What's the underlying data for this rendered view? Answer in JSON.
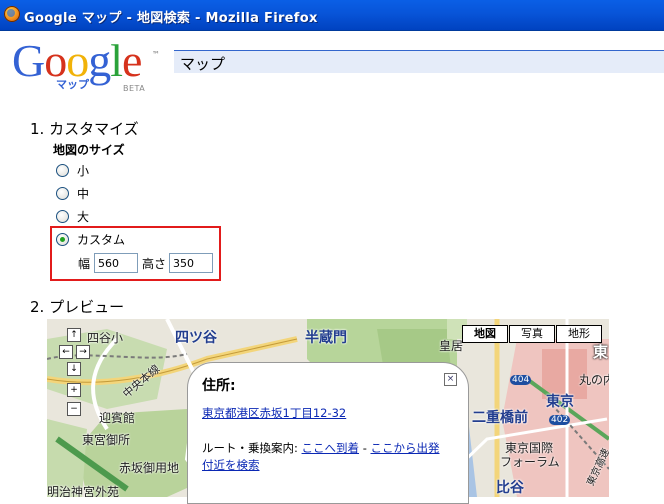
{
  "window": {
    "title": "Google マップ - 地図検索 - Mozilla Firefox"
  },
  "header": {
    "logo_text": "Google",
    "logo_sub": "マップ",
    "logo_beta": "BETA",
    "bar_title": "マップ"
  },
  "customize": {
    "heading": "1. カスタマイズ",
    "size_label": "地図のサイズ",
    "options": [
      {
        "label": "小",
        "selected": false
      },
      {
        "label": "中",
        "selected": false
      },
      {
        "label": "大",
        "selected": false
      },
      {
        "label": "カスタム",
        "selected": true
      }
    ],
    "width_label": "幅",
    "width_value": "560",
    "height_label": "高さ",
    "height_value": "350"
  },
  "preview": {
    "heading": "2. プレビュー",
    "map_types": {
      "map": "地図",
      "satellite": "写真",
      "hybrid": "地形"
    },
    "controls": {
      "up": "↑",
      "left": "←",
      "right": "→",
      "down": "↓",
      "zoom_in": "+",
      "zoom_out": "−"
    },
    "labels": {
      "yotsuya": "四ツ谷",
      "yotsuya4": "四谷小",
      "hanzomon": "半蔵門",
      "kojimachi": "皇居",
      "tokyo": "東京",
      "nihonbashi": "二重橋前",
      "marunouchi": "丸の内オ",
      "higashimiya": "東宮御所",
      "geihinkan": "迎賓館",
      "akasaka_goyochi": "赤坂御用地",
      "meiji": "明治神宮外苑",
      "tokyo_intl": "東京国際",
      "forum": "フォーラム",
      "chuo": "中央本線",
      "hibiya": "比谷",
      "hig": "東京高速",
      "higashi": "東",
      "route404": "404",
      "route402": "402"
    },
    "info": {
      "title": "住所:",
      "address": "東京都港区赤坂1丁目12-32",
      "route_label": "ルート・乗換案内:",
      "route_to": "ここへ到着",
      "route_sep": "-",
      "route_from": "ここから出発",
      "nearby": "付近を検索",
      "close": "×"
    }
  }
}
